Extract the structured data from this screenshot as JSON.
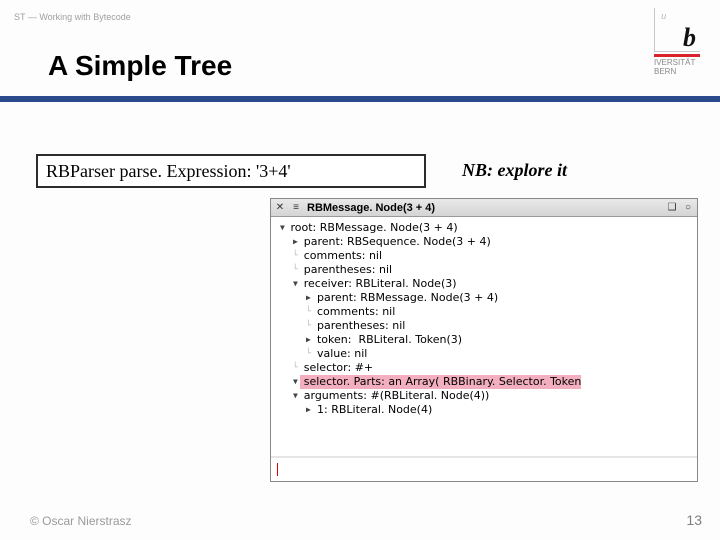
{
  "header": {
    "context": "ST — Working with Bytecode"
  },
  "logo": {
    "u": "u",
    "b": "b",
    "line1": " IVERSITÄT",
    "line2": "BERN"
  },
  "title": "A Simple Tree",
  "code": {
    "expr": "RBParser parse. Expression: '3+4'"
  },
  "note": "NB: explore it",
  "explorer": {
    "title": "RBMessage. Node(3 + 4)",
    "buttons": {
      "close": "✕",
      "menu": "≡",
      "min": "❑",
      "opt": "○"
    },
    "tree": [
      {
        "indent": 0,
        "disc": "down",
        "text": "root: RBMessage. Node(3 + 4)"
      },
      {
        "indent": 1,
        "disc": "right",
        "text": "parent: RBSequence. Node(3 + 4)"
      },
      {
        "indent": 1,
        "disc": "",
        "text": "comments: nil"
      },
      {
        "indent": 1,
        "disc": "",
        "text": "parentheses: nil"
      },
      {
        "indent": 1,
        "disc": "down",
        "text": "receiver: RBLiteral. Node(3)"
      },
      {
        "indent": 2,
        "disc": "right",
        "text": "parent: RBMessage. Node(3 + 4)"
      },
      {
        "indent": 2,
        "disc": "",
        "text": "comments: nil"
      },
      {
        "indent": 2,
        "disc": "",
        "text": "parentheses: nil"
      },
      {
        "indent": 2,
        "disc": "right",
        "text": "token:  RBLiteral. Token(3)"
      },
      {
        "indent": 2,
        "disc": "",
        "text": "value: nil"
      },
      {
        "indent": 1,
        "disc": "",
        "text": "selector: #+"
      },
      {
        "indent": 1,
        "disc": "down",
        "text": "selector. Parts: an Array( RBBinary. Selector. Token",
        "sel": true
      },
      {
        "indent": 1,
        "disc": "down",
        "text": "arguments: #(RBLiteral. Node(4))"
      },
      {
        "indent": 2,
        "disc": "right",
        "text": "1: RBLiteral. Node(4)"
      }
    ]
  },
  "footer": {
    "left": "© Oscar Nierstrasz",
    "page": "13"
  }
}
